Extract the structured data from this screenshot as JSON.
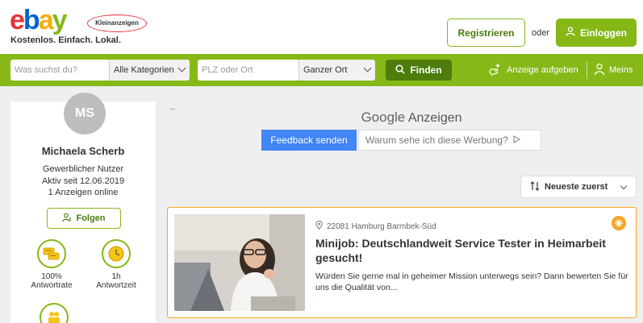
{
  "header": {
    "logo_text": "ebay",
    "logo_badge": "Kleinanzeigen",
    "tagline": "Kostenlos. Einfach. Lokal.",
    "register_label": "Registrieren",
    "or_label": "oder",
    "login_label": "Einloggen"
  },
  "search": {
    "query_placeholder": "Was suchst du?",
    "category_value": "Alle Kategorien",
    "location_placeholder": "PLZ oder Ort",
    "radius_value": "Ganzer Ort",
    "find_label": "Finden",
    "post_ad_label": "Anzeige aufgeben",
    "mine_label": "Meins"
  },
  "profile": {
    "initials": "MS",
    "name": "Michaela Scherb",
    "type": "Gewerblicher Nutzer",
    "active_since": "Aktiv seit 12.06.2019",
    "ads_online": "1 Anzeigen online",
    "follow_label": "Folgen",
    "stats": [
      {
        "value": "100%",
        "label": "Antwortrate"
      },
      {
        "value": "1h",
        "label": "Antwortzeit"
      }
    ]
  },
  "ads_block": {
    "google_label": "Google",
    "ads_label": "Anzeigen",
    "feedback_label": "Feedback senden",
    "why_label": "Warum sehe ich diese Werbung?"
  },
  "sort": {
    "label": "Neueste zuerst"
  },
  "listing": {
    "location": "22081 Hamburg Barmbek-Süd",
    "title": "Minijob: Deutschlandweit Service Tester in Heimarbeit gesucht!",
    "description": "Würden Sie gerne mal in geheimer Mission unterwegs sein? Dann bewerten Sie für uns die Qualität von..."
  },
  "colors": {
    "brand_green": "#86b817",
    "dark_green": "#4e7d0e",
    "google_blue": "#4285f4",
    "highlight_orange": "#f5a623"
  }
}
